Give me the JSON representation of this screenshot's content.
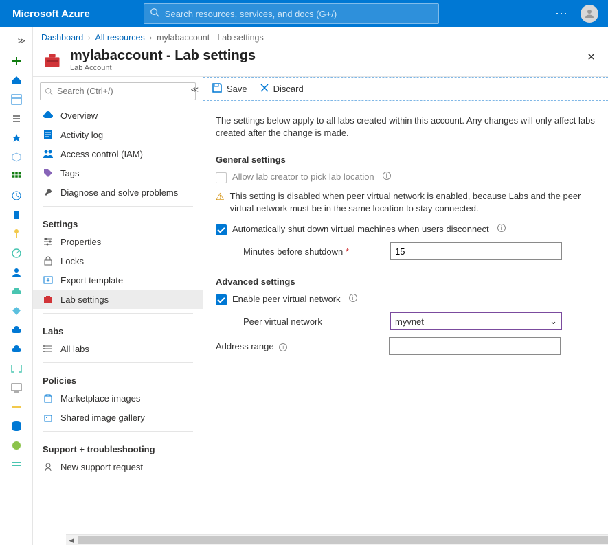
{
  "brand": "Microsoft Azure",
  "search_placeholder": "Search resources, services, and docs (G+/)",
  "breadcrumb": {
    "dashboard": "Dashboard",
    "allres": "All resources",
    "current": "mylabaccount - Lab settings"
  },
  "page": {
    "title": "mylabaccount - Lab settings",
    "subtitle": "Lab Account"
  },
  "res_search_placeholder": "Search (Ctrl+/)",
  "menu": {
    "overview": "Overview",
    "activity": "Activity log",
    "iam": "Access control (IAM)",
    "tags": "Tags",
    "diagnose": "Diagnose and solve problems",
    "sect_settings": "Settings",
    "properties": "Properties",
    "locks": "Locks",
    "export": "Export template",
    "labsettings": "Lab settings",
    "sect_labs": "Labs",
    "alllabs": "All labs",
    "sect_policies": "Policies",
    "marketplace": "Marketplace images",
    "sharedgal": "Shared image gallery",
    "sect_support": "Support + troubleshooting",
    "newreq": "New support request"
  },
  "toolbar": {
    "save": "Save",
    "discard": "Discard"
  },
  "form": {
    "description": "The settings below apply to all labs created within this account. Any changes will only affect labs created after the change is made.",
    "general_heading": "General settings",
    "allow_location": "Allow lab creator to pick lab location",
    "warn": "This setting is disabled when peer virtual network is enabled, because Labs and the peer virtual network must be in the same location to stay connected.",
    "auto_shutdown": "Automatically shut down virtual machines when users disconnect",
    "minutes_label": "Minutes before shutdown",
    "minutes_value": "15",
    "advanced_heading": "Advanced settings",
    "enable_peer": "Enable peer virtual network",
    "peer_label": "Peer virtual network",
    "peer_value": "myvnet",
    "addr_label": "Address range"
  }
}
